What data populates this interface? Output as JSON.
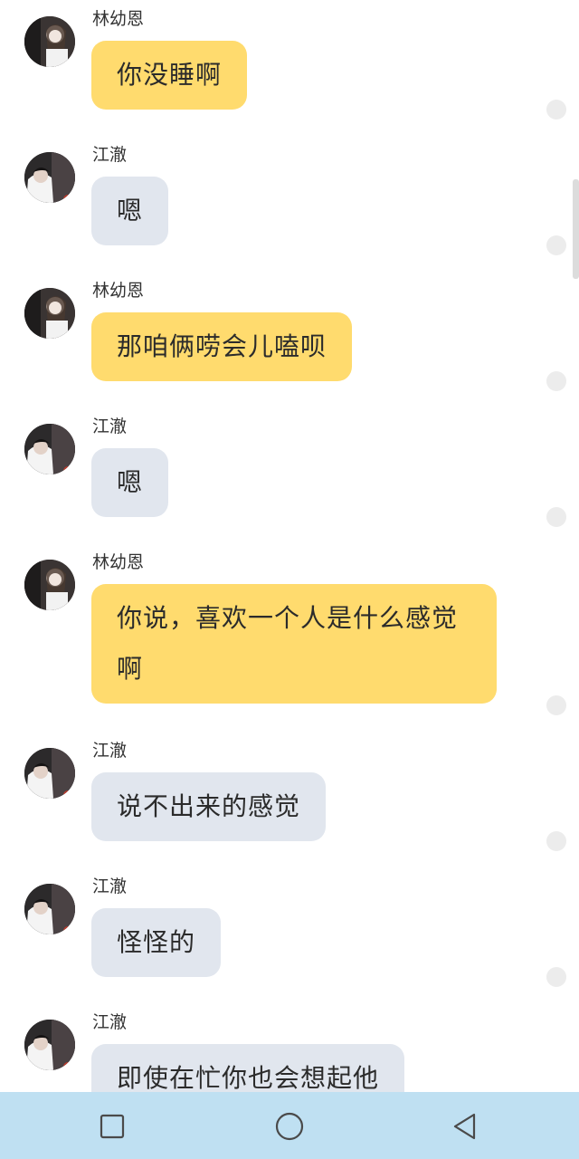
{
  "messages": [
    {
      "sender": "林幼恩",
      "text": "你没睡啊",
      "side": "her"
    },
    {
      "sender": "江澈",
      "text": "嗯",
      "side": "him"
    },
    {
      "sender": "林幼恩",
      "text": "那咱俩唠会儿嗑呗",
      "side": "her"
    },
    {
      "sender": "江澈",
      "text": "嗯",
      "side": "him"
    },
    {
      "sender": "林幼恩",
      "text": "你说，喜欢一个人是什么感觉啊",
      "side": "her"
    },
    {
      "sender": "江澈",
      "text": "说不出来的感觉",
      "side": "him"
    },
    {
      "sender": "江澈",
      "text": "怪怪的",
      "side": "him"
    },
    {
      "sender": "江澈",
      "text": "即使在忙你也会想起他",
      "side": "him"
    }
  ],
  "nav": {
    "recents_icon": "square-icon",
    "home_icon": "circle-icon",
    "back_icon": "triangle-back-icon"
  },
  "colors": {
    "her_bubble": "#ffdb6e",
    "his_bubble": "#e1e6ee",
    "navbar": "#bfe0f2"
  }
}
